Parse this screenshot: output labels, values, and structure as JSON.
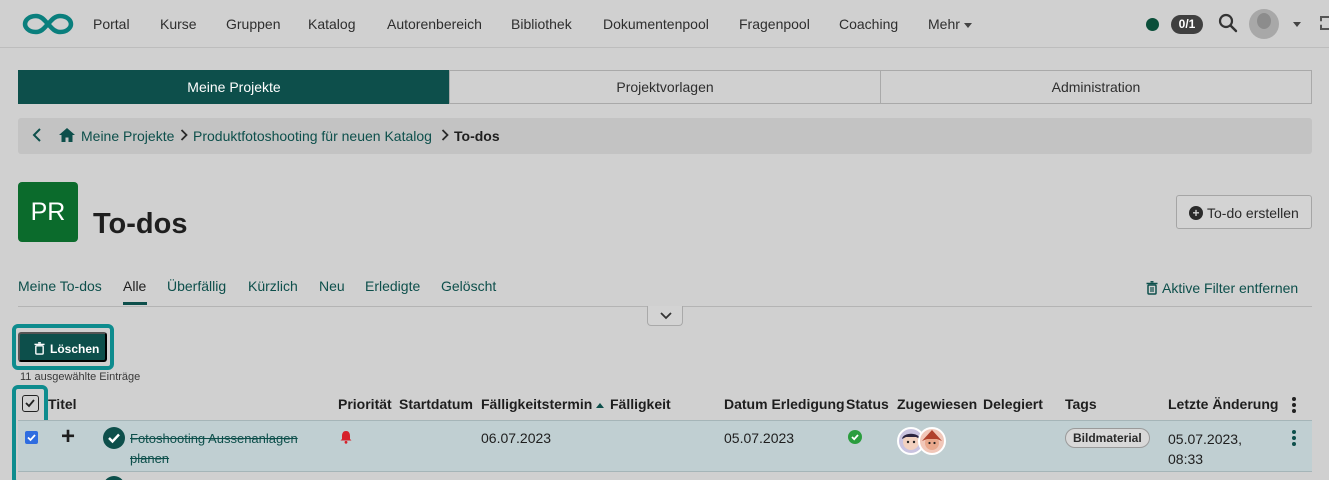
{
  "nav": {
    "items": [
      "Portal",
      "Kurse",
      "Gruppen",
      "Katalog",
      "Autorenbereich",
      "Bibliothek",
      "Dokumentenpool",
      "Fragenpool",
      "Coaching",
      "Mehr"
    ],
    "counter": "0/1",
    "logo_icon": "infinity-logo-icon",
    "colors": {
      "brand": "#0d4f4b",
      "online": "#0b4f3a"
    }
  },
  "tabs": [
    "Meine Projekte",
    "Projektvorlagen",
    "Administration"
  ],
  "breadcrumb": {
    "items": [
      "Meine Projekte",
      "Produktfotoshooting für neuen Katalog"
    ],
    "current": "To-dos"
  },
  "project": {
    "initials": "PR",
    "title": "To-dos",
    "create_label": "To-do erstellen"
  },
  "filters": {
    "tabs": [
      "Meine To-dos",
      "Alle",
      "Überfällig",
      "Kürzlich",
      "Neu",
      "Erledigte",
      "Gelöscht"
    ],
    "active": "Alle",
    "clear_label": "Aktive Filter entfernen"
  },
  "actions": {
    "delete_label": "Löschen",
    "selected_text": "11 ausgewählte Einträge"
  },
  "table": {
    "columns": [
      "Titel",
      "Priorität",
      "Startdatum",
      "Fälligkeitstermin",
      "Fälligkeit",
      "Datum Erledigung",
      "Status",
      "Zugewiesen",
      "Delegiert",
      "Tags",
      "Letzte Änderung"
    ],
    "sorted_column": "Fälligkeitstermin",
    "rows": [
      {
        "title": "Fotoshooting Aussenanlagen planen",
        "priority_icon": "bell-icon",
        "start": "",
        "due": "06.07.2023",
        "due_state": "",
        "done_date": "05.07.2023",
        "status_icon": "check-circle-icon",
        "tag": "Bildmaterial",
        "last_change": "05.07.2023, 08:33"
      }
    ]
  }
}
